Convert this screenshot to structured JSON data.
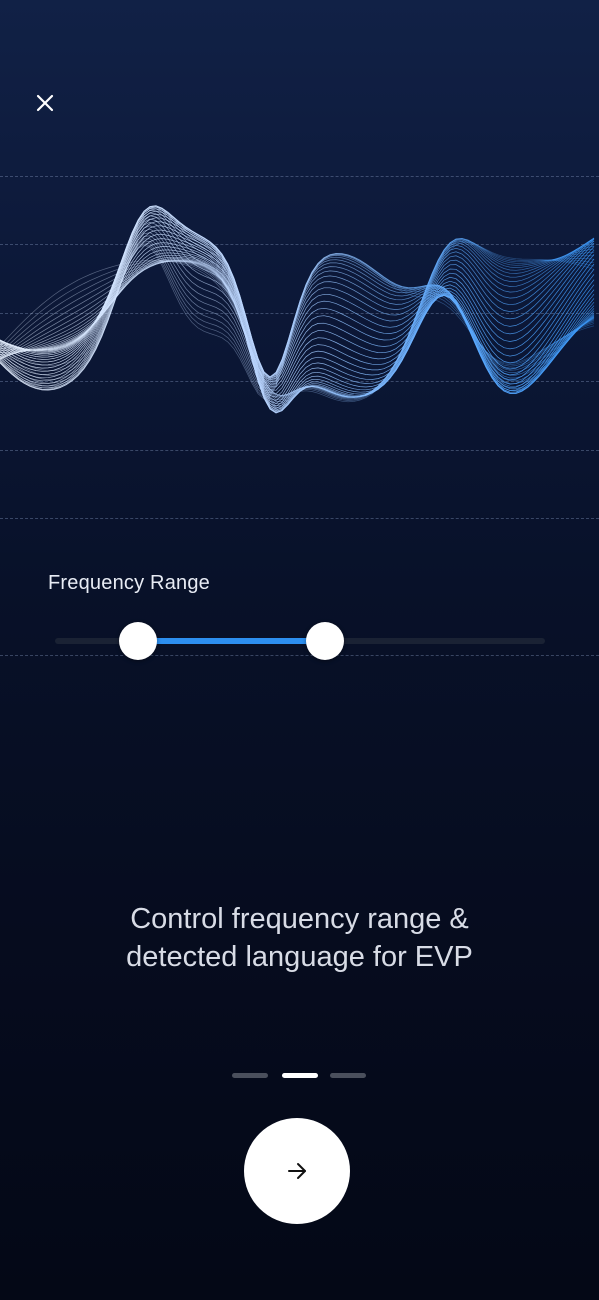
{
  "header": {
    "close_icon": "close-icon"
  },
  "frequency": {
    "label": "Frequency Range",
    "range_low": 0.17,
    "range_high": 0.55,
    "fill_color": "#2d8ff0"
  },
  "onboarding": {
    "caption_line1": "Control frequency range &",
    "caption_line2": "detected language for EVP",
    "page_count": 3,
    "active_page": 2
  },
  "footer": {
    "next_icon": "arrow-right-icon"
  },
  "colors": {
    "wave_white": "#e6f0ff",
    "wave_blue": "#3a9bff",
    "background_top": "#112146",
    "background_bottom": "#040816"
  }
}
